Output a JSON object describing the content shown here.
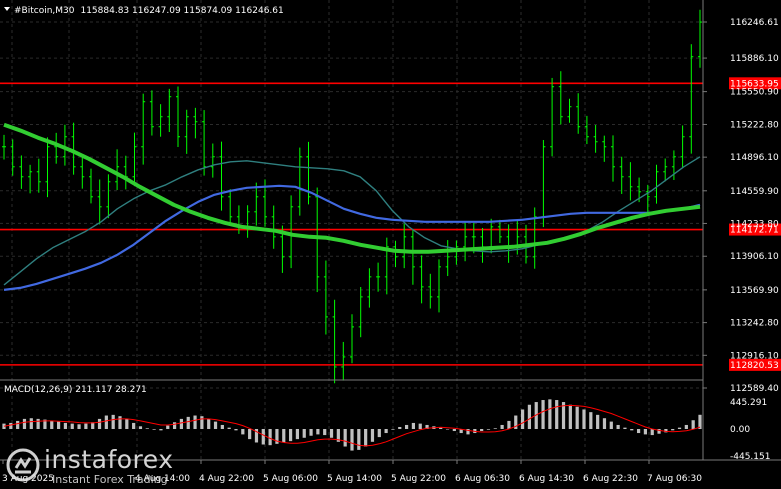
{
  "header": {
    "symbol": "#Bitcoin,M30",
    "ohlc": "115884.83 116247.09 115874.09 116246.61"
  },
  "price_axis": {
    "ticks": [
      "116246.61",
      "115886.10",
      "115550.90",
      "115222.80",
      "114896.10",
      "114559.90",
      "114233.80",
      "113906.10",
      "113569.90",
      "113242.80",
      "112916.10",
      "112589.40"
    ],
    "level_labels": [
      "115633.95",
      "114172.71",
      "112820.53"
    ],
    "current_price": "116246.61"
  },
  "time_axis": {
    "labels": [
      "3 Aug 2025",
      "4 Aug 14:00",
      "4 Aug 22:00",
      "5 Aug 06:00",
      "5 Aug 14:00",
      "5 Aug 22:00",
      "6 Aug 06:30",
      "6 Aug 14:30",
      "6 Aug 22:30",
      "7 Aug 06:30"
    ]
  },
  "macd": {
    "label": "MACD(12,26,9) 211.117 28.271",
    "ticks": [
      "445.291",
      "0.00",
      "-445.151"
    ]
  },
  "watermark": {
    "brand": "instaforex",
    "tagline": "Instant Forex Trading"
  },
  "colors": {
    "background": "#000000",
    "grid": "#2b2b2b",
    "bull_candle": "#00ff00",
    "level_line": "#ff0000",
    "ma_fast": "#2f7f7f",
    "ma_mid": "#4169e1",
    "ma_slow": "#32cd32",
    "macd_hist": "#c0c0c0",
    "macd_signal": "#ff0000"
  },
  "chart_data": {
    "type": "candlestick",
    "price_range": [
      112589.4,
      116246.61
    ],
    "levels": [
      115633.95,
      114172.71,
      112820.53
    ],
    "ma_fast": [
      113620,
      113750,
      113880,
      113990,
      114070,
      114150,
      114250,
      114380,
      114480,
      114560,
      114620,
      114700,
      114770,
      114820,
      114850,
      114860,
      114840,
      114820,
      114800,
      114790,
      114780,
      114760,
      114700,
      114560,
      114360,
      114200,
      114090,
      114010,
      113980,
      113960,
      113950,
      113960,
      113980,
      114020,
      114060,
      114100,
      114160,
      114250,
      114360,
      114460,
      114560,
      114680,
      114800,
      114900
    ],
    "ma_mid": [
      113570,
      113590,
      113630,
      113680,
      113730,
      113780,
      113840,
      113920,
      114020,
      114140,
      114260,
      114360,
      114450,
      114520,
      114560,
      114590,
      114600,
      114610,
      114600,
      114540,
      114460,
      114380,
      114330,
      114290,
      114270,
      114260,
      114250,
      114250,
      114250,
      114250,
      114250,
      114260,
      114270,
      114290,
      114310,
      114330,
      114340,
      114340,
      114340,
      114340,
      114340,
      114360,
      114380,
      114420
    ],
    "ma_slow": [
      115220,
      115160,
      115090,
      115030,
      114960,
      114880,
      114790,
      114700,
      114600,
      114510,
      114420,
      114350,
      114290,
      114240,
      114200,
      114180,
      114160,
      114120,
      114100,
      114090,
      114060,
      114020,
      113990,
      113960,
      113950,
      113950,
      113960,
      113970,
      113980,
      113990,
      114000,
      114020,
      114040,
      114080,
      114130,
      114190,
      114240,
      114290,
      114330,
      114360,
      114380,
      114400
    ],
    "macd_hist": [
      80,
      90,
      120,
      150,
      160,
      150,
      140,
      120,
      110,
      90,
      80,
      70,
      80,
      100,
      150,
      200,
      210,
      190,
      150,
      90,
      40,
      10,
      -10,
      -20,
      50,
      100,
      150,
      180,
      200,
      190,
      150,
      110,
      60,
      20,
      -20,
      -80,
      -150,
      -200,
      -230,
      -240,
      -220,
      -200,
      -180,
      -150,
      -130,
      -100,
      -80,
      -90,
      -130,
      -190,
      -260,
      -320,
      -310,
      -260,
      -190,
      -120,
      -60,
      -10,
      30,
      60,
      90,
      80,
      60,
      40,
      20,
      0,
      -30,
      -60,
      -80,
      -60,
      -30,
      -10,
      10,
      60,
      120,
      200,
      290,
      360,
      400,
      430,
      440,
      430,
      400,
      360,
      330,
      290,
      250,
      210,
      160,
      110,
      60,
      20,
      -20,
      -60,
      -80,
      -90,
      -70,
      -50,
      -20,
      20,
      60,
      130,
      211
    ],
    "macd_signal": [
      40,
      60,
      80,
      100,
      110,
      115,
      120,
      120,
      115,
      110,
      105,
      95,
      90,
      90,
      100,
      120,
      140,
      150,
      150,
      140,
      120,
      100,
      80,
      60,
      60,
      70,
      90,
      110,
      130,
      150,
      150,
      140,
      120,
      100,
      80,
      50,
      10,
      -40,
      -90,
      -140,
      -180,
      -200,
      -210,
      -210,
      -200,
      -180,
      -160,
      -150,
      -150,
      -160,
      -180,
      -210,
      -240,
      -250,
      -240,
      -220,
      -190,
      -150,
      -110,
      -70,
      -40,
      -10,
      10,
      20,
      25,
      20,
      10,
      -5,
      -20,
      -35,
      -45,
      -45,
      -40,
      -25,
      0,
      40,
      90,
      150,
      210,
      260,
      300,
      330,
      345,
      350,
      345,
      335,
      315,
      290,
      260,
      230,
      190,
      150,
      110,
      70,
      30,
      0,
      -20,
      -35,
      -40,
      -35,
      -25,
      -5,
      28
    ]
  }
}
